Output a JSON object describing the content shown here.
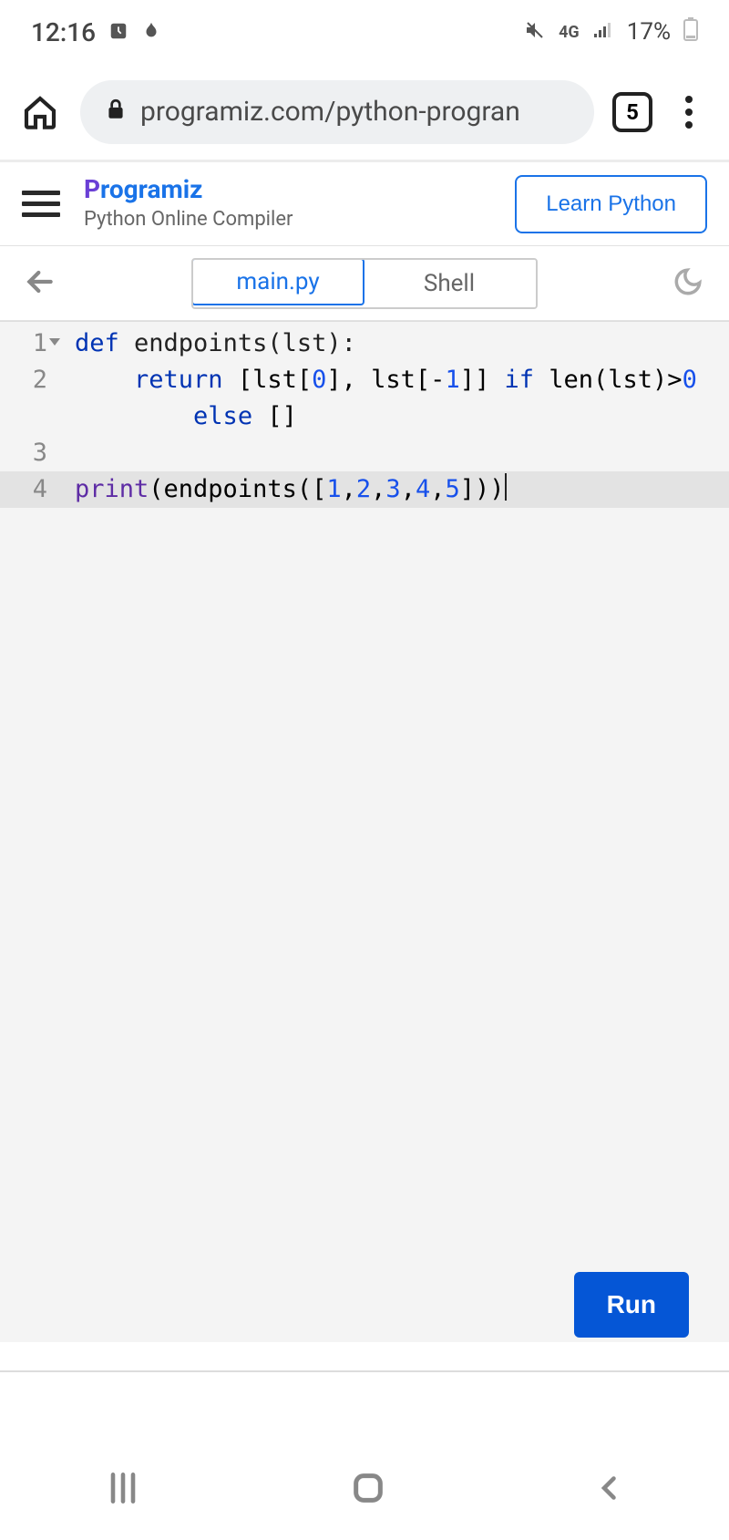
{
  "status": {
    "time": "12:16",
    "battery": "17%",
    "network": "4G"
  },
  "browser": {
    "url": "programiz.com/python-progran",
    "tabs": "5"
  },
  "site": {
    "logo_prefix": "P",
    "logo_rest": "rogramiz",
    "subtitle": "Python Online Compiler",
    "learn_label": "Learn Python"
  },
  "tabs": {
    "active": "main.py",
    "inactive": "Shell"
  },
  "code": {
    "l1_a": "def",
    "l1_b": " endpoints(lst):",
    "l2_a": "    ",
    "l2_b": "return",
    "l2_c": " [lst[",
    "l2_d": "0",
    "l2_e": "], lst[-",
    "l2_f": "1",
    "l2_g": "]] ",
    "l2_h": "if",
    "l2_i": " len(lst)>",
    "l2_j": "0",
    "l2w_a": "        ",
    "l2w_b": "else",
    "l2w_c": " []",
    "l3": "",
    "l4_a": "print",
    "l4_b": "(endpoints([",
    "l4_c": "1",
    "l4_d": ",",
    "l4_e": "2",
    "l4_f": ",",
    "l4_g": "3",
    "l4_h": ",",
    "l4_i": "4",
    "l4_j": ",",
    "l4_k": "5",
    "l4_l": "]))"
  },
  "gutter": {
    "n1": "1",
    "n2": "2",
    "n3": "3",
    "n4": "4"
  },
  "run_label": "Run"
}
